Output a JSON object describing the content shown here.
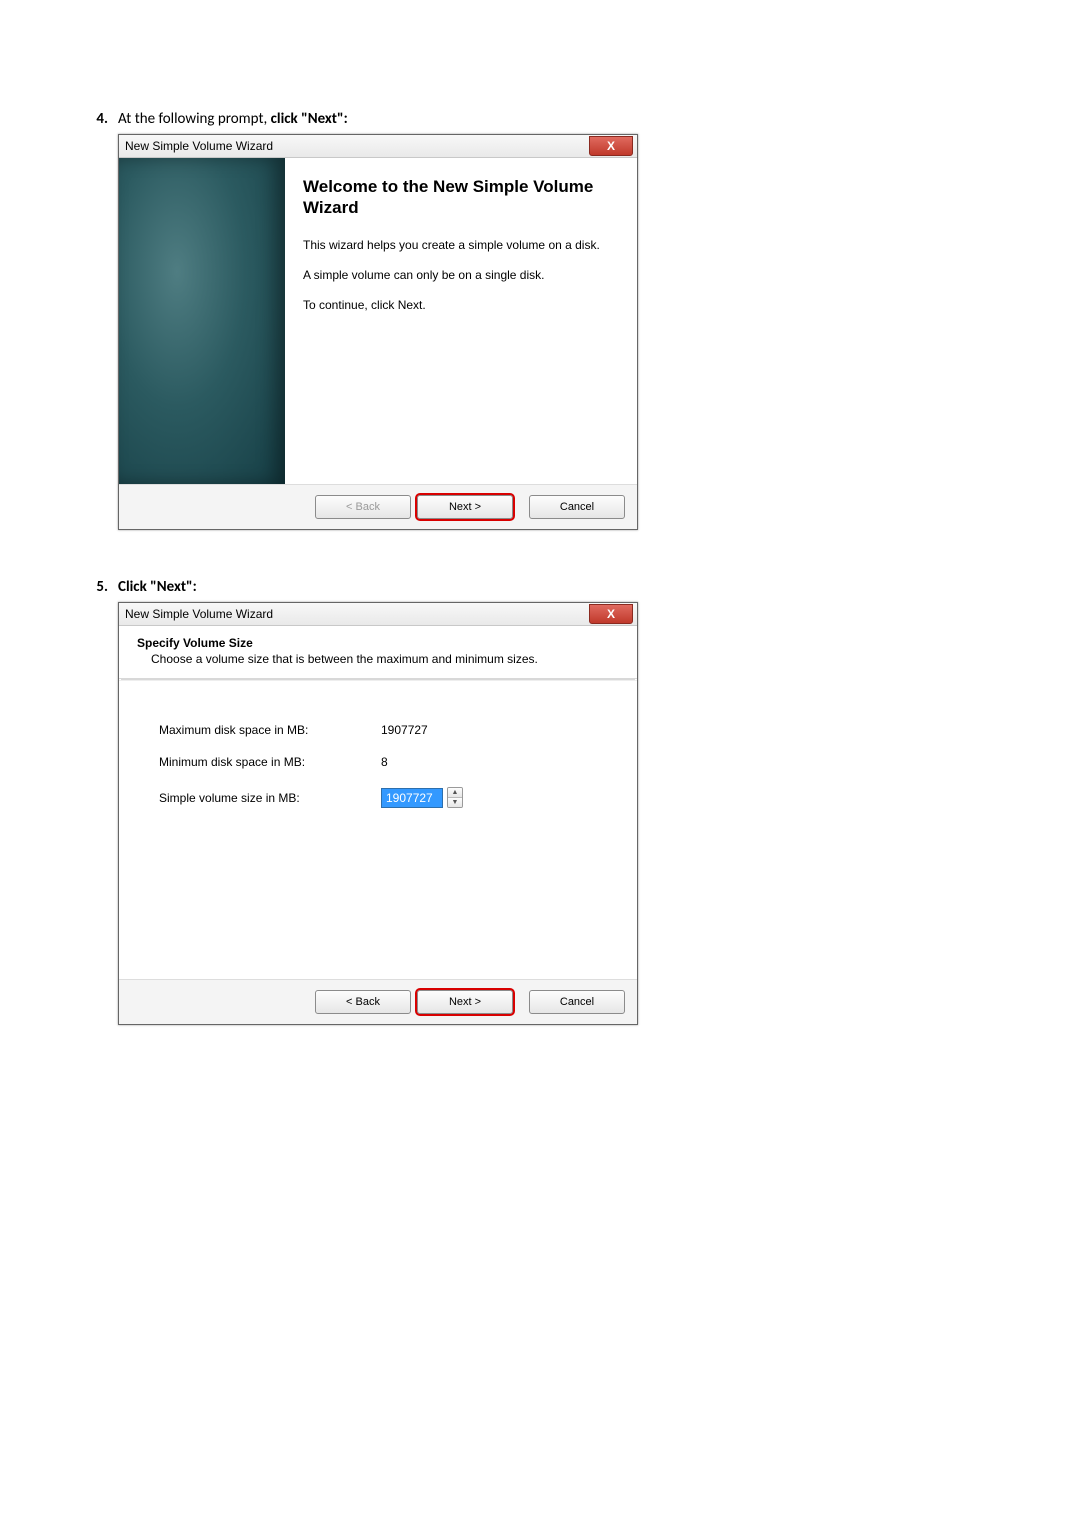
{
  "steps": {
    "s4": {
      "num": "4.",
      "text_plain": "At the following prompt, ",
      "text_bold": "click \"Next\":"
    },
    "s5": {
      "num": "5.",
      "text_bold": "Click \"Next\":"
    }
  },
  "dialog1": {
    "title": "New Simple Volume Wizard",
    "heading": "Welcome to the New Simple Volume Wizard",
    "p1": "This wizard helps you create a simple volume on a disk.",
    "p2": "A simple volume can only be on a single disk.",
    "p3": "To continue, click Next.",
    "buttons": {
      "back": "< Back",
      "next": "Next >",
      "cancel": "Cancel"
    }
  },
  "dialog2": {
    "title": "New Simple Volume Wizard",
    "header_title": "Specify Volume Size",
    "header_sub": "Choose a volume size that is between the maximum and minimum sizes.",
    "rows": {
      "max_label": "Maximum disk space in MB:",
      "max_value": "1907727",
      "min_label": "Minimum disk space in MB:",
      "min_value": "8",
      "size_label": "Simple volume size in MB:",
      "size_value": "1907727"
    },
    "buttons": {
      "back": "< Back",
      "next": "Next >",
      "cancel": "Cancel"
    }
  },
  "icons": {
    "close": "X",
    "up": "▲",
    "down": "▼"
  }
}
